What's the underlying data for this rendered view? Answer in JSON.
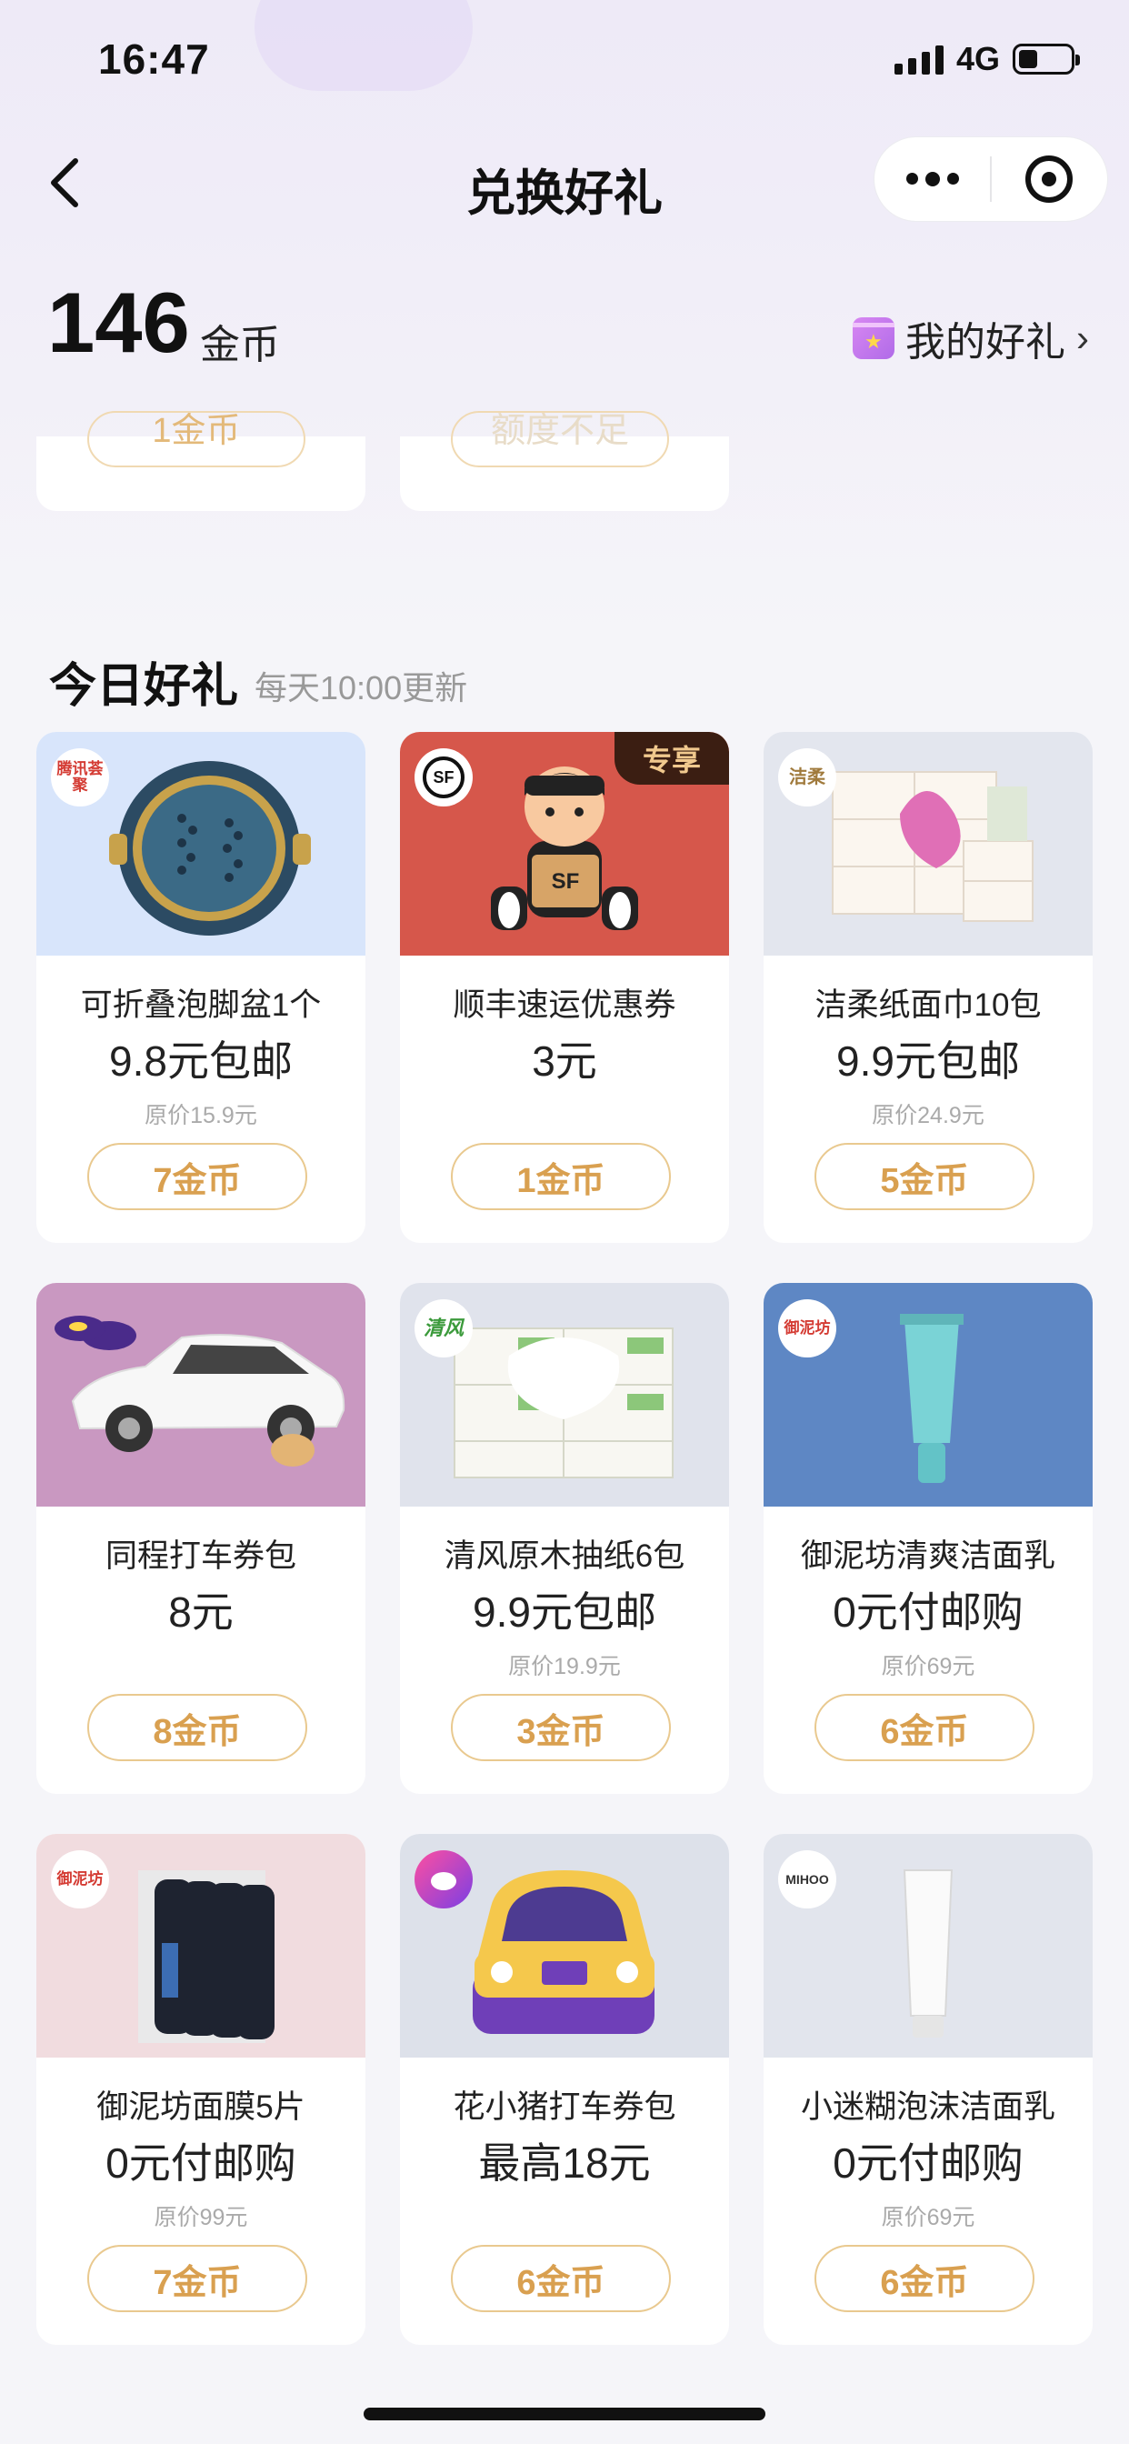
{
  "status_bar": {
    "time": "16:47",
    "network": "4G"
  },
  "nav": {
    "title": "兑换好礼"
  },
  "coins": {
    "amount": "146",
    "unit": "金币"
  },
  "my_gifts": {
    "label": "我的好礼"
  },
  "partial_cards": [
    {
      "button": "1金币"
    },
    {
      "button": "额度不足"
    }
  ],
  "section": {
    "title": "今日好礼",
    "subtitle": "每天10:00更新"
  },
  "products": [
    {
      "name": "可折叠泡脚盆1个",
      "price": "9.8元包邮",
      "original": "原价15.9元",
      "button": "7金币",
      "logo": "腾讯荟聚",
      "bg": "#d8e5fb"
    },
    {
      "name": "顺丰速运优惠券",
      "price": "3元",
      "original": "",
      "button": "1金币",
      "logo": "SF",
      "tag": "专享",
      "bg": "#d6574b"
    },
    {
      "name": "洁柔纸面巾10包",
      "price": "9.9元包邮",
      "original": "原价24.9元",
      "button": "5金币",
      "logo": "洁柔",
      "bg": "#e3e6ee"
    },
    {
      "name": "同程打车券包",
      "price": "8元",
      "original": "",
      "button": "8金币",
      "logo": "",
      "bg": "#c998c1"
    },
    {
      "name": "清风原木抽纸6包",
      "price": "9.9元包邮",
      "original": "原价19.9元",
      "button": "3金币",
      "logo": "清风",
      "bg": "#e0e3ec"
    },
    {
      "name": "御泥坊清爽洁面乳",
      "price": "0元付邮购",
      "original": "原价69元",
      "button": "6金币",
      "logo": "御泥坊",
      "bg": "#5e87c4"
    },
    {
      "name": "御泥坊面膜5片",
      "price": "0元付邮购",
      "original": "原价99元",
      "button": "7金币",
      "logo": "御泥坊",
      "bg": "#f1dcdf"
    },
    {
      "name": "花小猪打车券包",
      "price": "最高18元",
      "original": "",
      "button": "6金币",
      "logo": "",
      "bg": "#dde1ea"
    },
    {
      "name": "小迷糊泡沫洁面乳",
      "price": "0元付邮购",
      "original": "原价69元",
      "button": "6金币",
      "logo": "MIHOO",
      "bg": "#e2e5ed"
    }
  ]
}
